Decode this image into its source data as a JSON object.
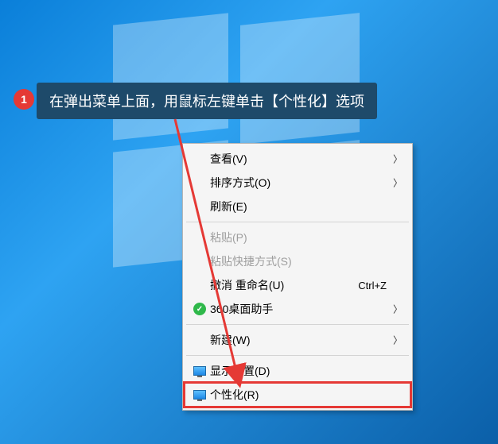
{
  "callout": {
    "badge": "1",
    "text": "在弹出菜单上面，用鼠标左键单击【个性化】选项"
  },
  "menu": {
    "items": [
      {
        "label": "查看(V)",
        "has_submenu": true
      },
      {
        "label": "排序方式(O)",
        "has_submenu": true
      },
      {
        "label": "刷新(E)"
      },
      {
        "sep": true
      },
      {
        "label": "粘贴(P)",
        "disabled": true
      },
      {
        "label": "粘贴快捷方式(S)",
        "disabled": true
      },
      {
        "label": "撤消 重命名(U)",
        "shortcut": "Ctrl+Z"
      },
      {
        "label": "360桌面助手",
        "icon": "360",
        "has_submenu": true
      },
      {
        "sep": true
      },
      {
        "label": "新建(W)",
        "has_submenu": true
      },
      {
        "sep": true
      },
      {
        "label": "显示设置(D)",
        "icon": "monitor"
      },
      {
        "label": "个性化(R)",
        "icon": "monitor",
        "highlighted": true
      }
    ]
  }
}
